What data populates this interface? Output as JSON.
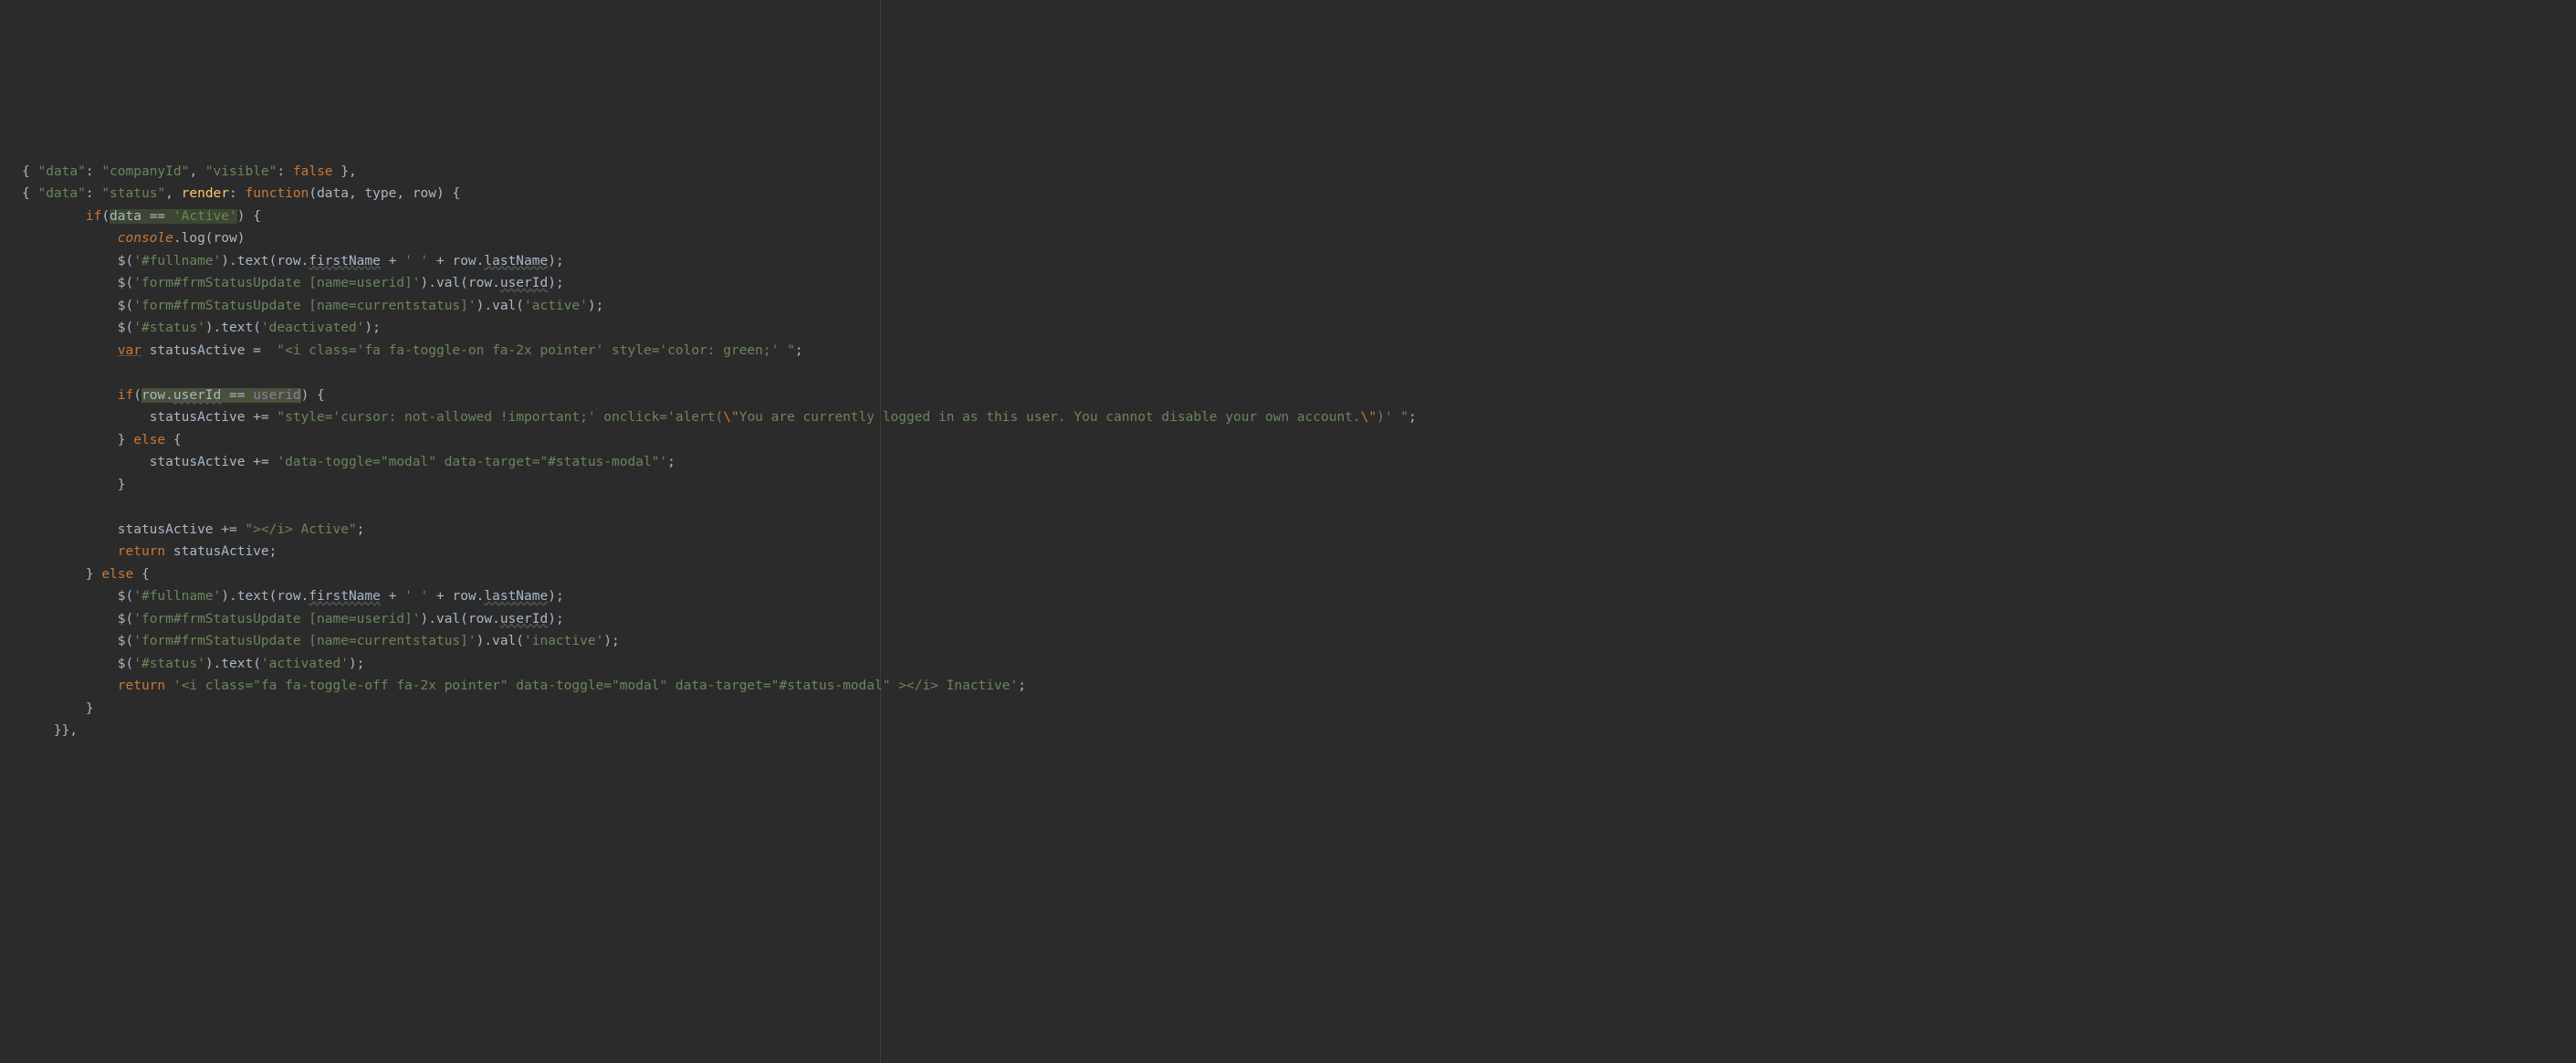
{
  "lines": {
    "l1_open": "{ ",
    "l1_data": "\"data\"",
    "l1_colon": ": ",
    "l1_val": "\"companyId\"",
    "l1_comma": ", ",
    "l1_vis": "\"visible\"",
    "l1_colon2": ": ",
    "l1_false": "false",
    "l1_close": " },",
    "l2_open": "{ ",
    "l2_data": "\"data\"",
    "l2_colon": ": ",
    "l2_val": "\"status\"",
    "l2_comma": ", ",
    "l2_render": "render",
    "l2_colon2": ": ",
    "l2_func": "function",
    "l2_args": "(data, type, row) {",
    "l3_if": "if",
    "l3_open": "(",
    "l3_cond_a": "data ",
    "l3_cond_b": "== ",
    "l3_cond_c": "'Active'",
    "l3_close": ") {",
    "l4_console": "console",
    "l4_log": ".log(row)",
    "l5_jq": "$(",
    "l5_sel": "'#fullname'",
    "l5_txt": ").text(row.",
    "l5_fn": "firstName",
    "l5_plus": " + ",
    "l5_sp": "' '",
    "l5_plus2": " + row.",
    "l5_ln": "lastName",
    "l5_end": ");",
    "l6_jq": "$(",
    "l6_sel": "'form#frmStatusUpdate [name=userid]'",
    "l6_val": ").val(row.",
    "l6_uid": "userId",
    "l6_end": ");",
    "l7_jq": "$(",
    "l7_sel": "'form#frmStatusUpdate [name=currentstatus]'",
    "l7_val": ").val(",
    "l7_s": "'active'",
    "l7_end": ");",
    "l8_jq": "$(",
    "l8_sel": "'#status'",
    "l8_txt": ").text(",
    "l8_s": "'deactivated'",
    "l8_end": ");",
    "l9_var": "var",
    "l9_name": " statusActive =  ",
    "l9_s": "\"<i class='fa fa-toggle-on fa-2x pointer' style='color: green;' \"",
    "l9_end": ";",
    "l10_if": "if",
    "l10_open": "(",
    "l10_a": "row.",
    "l10_uid": "userId",
    "l10_eq": " == ",
    "l10_b": "userid",
    "l10_close": ") {",
    "l11_a": "statusActive += ",
    "l11_s": "\"style='cursor: not-allowed !important;' onclick='alert(",
    "l11_esc1": "\\\"",
    "l11_msg": "You are currently logged in as this user. You cannot disable your own account.",
    "l11_esc2": "\\\"",
    "l11_s2": ")' \"",
    "l11_end": ";",
    "l12": "} ",
    "l12_else": "else",
    "l12_b": " {",
    "l13_a": "statusActive += ",
    "l13_s": "'data-toggle=\"modal\" data-target=\"#status-modal\"'",
    "l13_end": ";",
    "l14": "}",
    "l15_a": "statusActive += ",
    "l15_s": "\"></i> Active\"",
    "l15_end": ";",
    "l16_ret": "return",
    "l16_b": " statusActive;",
    "l17": "} ",
    "l17_else": "else",
    "l17_b": " {",
    "l18_jq": "$(",
    "l18_sel": "'#fullname'",
    "l18_txt": ").text(row.",
    "l18_fn": "firstName",
    "l18_plus": " + ",
    "l18_sp": "' '",
    "l18_plus2": " + row.",
    "l18_ln": "lastName",
    "l18_end": ");",
    "l19_jq": "$(",
    "l19_sel": "'form#frmStatusUpdate [name=userid]'",
    "l19_val": ").val(row.",
    "l19_uid": "userId",
    "l19_end": ");",
    "l20_jq": "$(",
    "l20_sel": "'form#frmStatusUpdate [name=currentstatus]'",
    "l20_val": ").val(",
    "l20_s": "'inactive'",
    "l20_end": ");",
    "l21_jq": "$(",
    "l21_sel": "'#status'",
    "l21_txt": ").text(",
    "l21_s": "'activated'",
    "l21_end": ");",
    "l22_ret": "return",
    "l22_sp": " ",
    "l22_s": "'<i class=\"fa fa-toggle-off fa-2x pointer\" data-toggle=\"modal\" data-target=\"#status-modal\" ></i> Inactive'",
    "l22_end": ";",
    "l23": "}",
    "l24": "}},"
  }
}
